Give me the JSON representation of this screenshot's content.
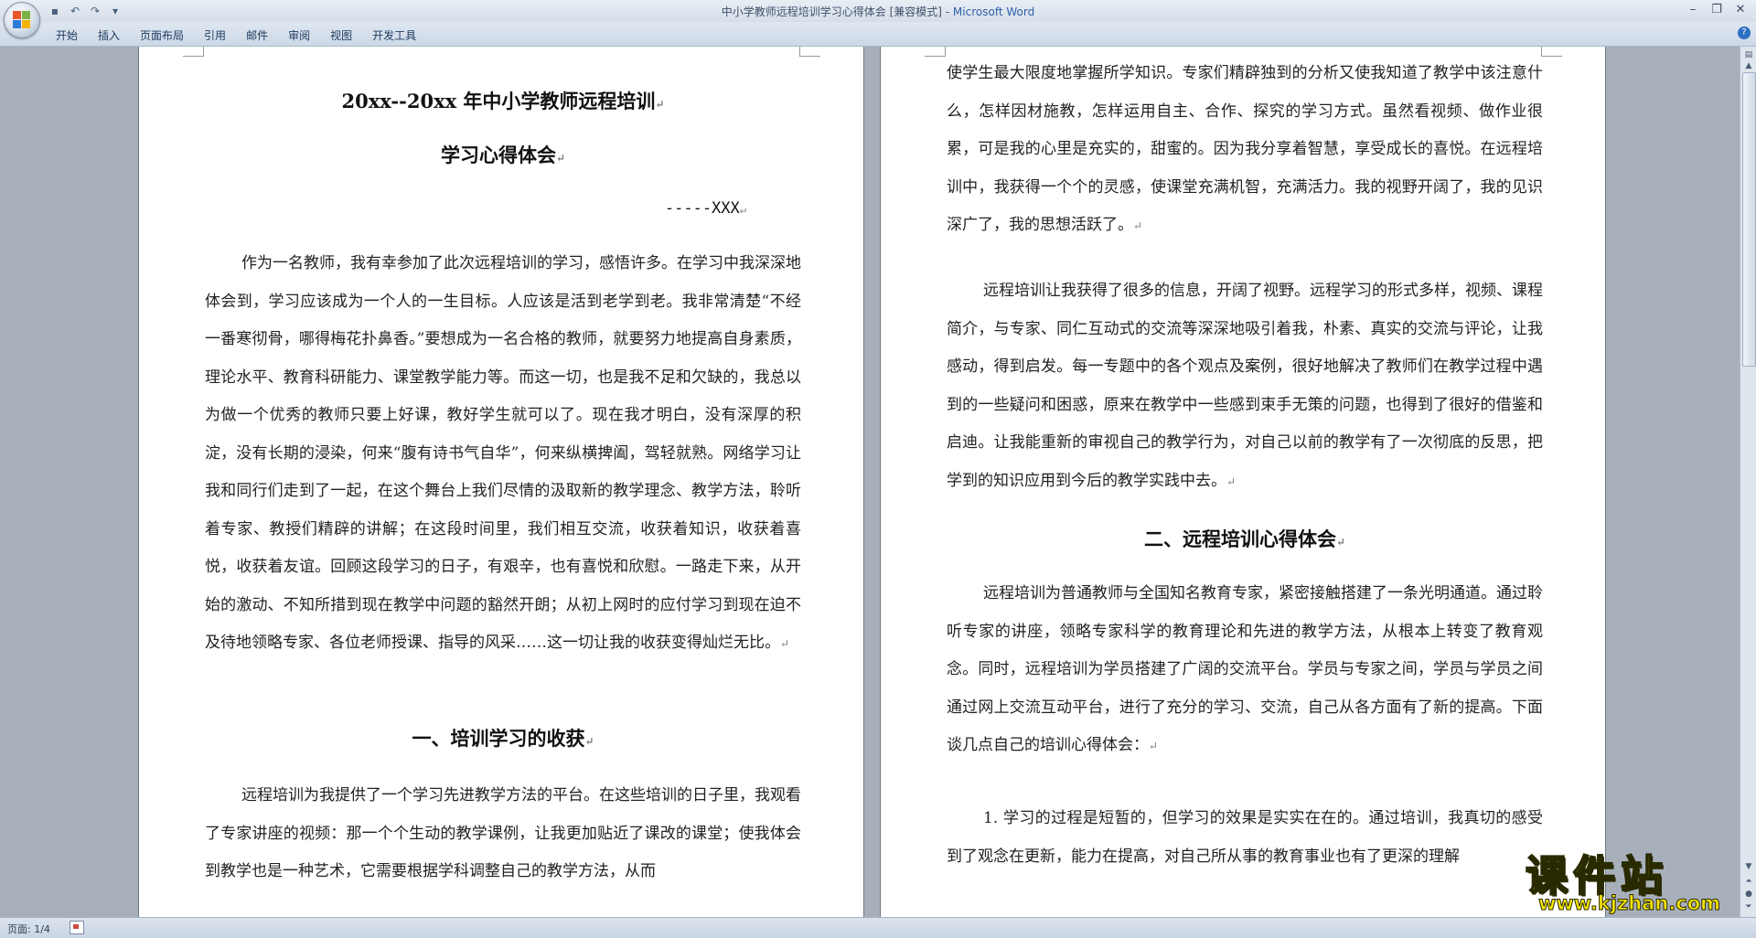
{
  "window": {
    "title": "中小学教师远程培训学习心得体会 [兼容模式] - ",
    "app": "Microsoft Word",
    "controls": [
      "minimize-icon",
      "restore-icon",
      "close-icon"
    ]
  },
  "quick_access": [
    "save-icon",
    "undo-icon",
    "redo-icon",
    "customize-icon"
  ],
  "ribbon": {
    "tabs": [
      "开始",
      "插入",
      "页面布局",
      "引用",
      "邮件",
      "审阅",
      "视图",
      "开发工具"
    ]
  },
  "page1": {
    "title_line1": "20xx--20xx 年中小学教师远程培训",
    "title_line2": "学习心得体会",
    "author": "-----XXX",
    "para1": "作为一名教师，我有幸参加了此次远程培训的学习，感悟许多。在学习中我深深地体会到，学习应该成为一个人的一生目标。人应该是活到老学到老。我非常清楚“不经一番寒彻骨，哪得梅花扑鼻香。”要想成为一名合格的教师，就要努力地提高自身素质，理论水平、教育科研能力、课堂教学能力等。而这一切，也是我不足和欠缺的，我总以为做一个优秀的教师只要上好课，教好学生就可以了。现在我才明白，没有深厚的积淀，没有长期的浸染，何来“腹有诗书气自华”，何来纵横捭阖，驾轻就熟。网络学习让我和同行们走到了一起，在这个舞台上我们尽情的汲取新的教学理念、教学方法，聆听着专家、教授们精辟的讲解；在这段时间里，我们相互交流，收获着知识，收获着喜悦，收获着友谊。回顾这段学习的日子，有艰辛，也有喜悦和欣慰。一路走下来，从开始的激动、不知所措到现在教学中问题的豁然开朗；从初上网时的应付学习到现在迫不及待地领略专家、各位老师授课、指导的风采……这一切让我的收获变得灿烂无比。",
    "heading1": "一、培训学习的收获",
    "para2": "远程培训为我提供了一个学习先进教学方法的平台。在这些培训的日子里，我观看了专家讲座的视频：那一个个生动的教学课例，让我更加贴近了课改的课堂；使我体会到教学也是一种艺术，它需要根据学科调整自己的教学方法，从而"
  },
  "page2": {
    "para1": "使学生最大限度地掌握所学知识。专家们精辟独到的分析又使我知道了教学中该注意什么，怎样因材施教，怎样运用自主、合作、探究的学习方式。虽然看视频、做作业很累，可是我的心里是充实的，甜蜜的。因为我分享着智慧，享受成长的喜悦。在远程培训中，我获得一个个的灵感，使课堂充满机智，充满活力。我的视野开阔了，我的见识深广了，我的思想活跃了。",
    "para2": "远程培训让我获得了很多的信息，开阔了视野。远程学习的形式多样，视频、课程简介，与专家、同仁互动式的交流等深深地吸引着我，朴素、真实的交流与评论，让我感动，得到启发。每一专题中的各个观点及案例，很好地解决了教师们在教学过程中遇到的一些疑问和困惑，原来在教学中一些感到束手无策的问题，也得到了很好的借鉴和启迪。让我能重新的审视自己的教学行为，对自己以前的教学有了一次彻底的反思，把学到的知识应用到今后的教学实践中去。",
    "heading2": "二、远程培训心得体会",
    "para3": "远程培训为普通教师与全国知名教育专家，紧密接触搭建了一条光明通道。通过聆听专家的讲座，领略专家科学的教育理论和先进的教学方法，从根本上转变了教育观念。同时，远程培训为学员搭建了广阔的交流平台。学员与专家之间，学员与学员之间通过网上交流互动平台，进行了充分的学习、交流，自己从各方面有了新的提高。下面谈几点自己的培训心得体会：",
    "para4": "1. 学习的过程是短暂的，但学习的效果是实实在在的。通过培训，我真切的感受到了观念在更新，能力在提高，对自己所从事的教育事业也有了更深的理解"
  },
  "status": {
    "page": "页面: 1/4"
  },
  "watermark": {
    "big": "课件站",
    "url": "www.kjzhan.com"
  },
  "marks": {
    "para": "↵"
  }
}
